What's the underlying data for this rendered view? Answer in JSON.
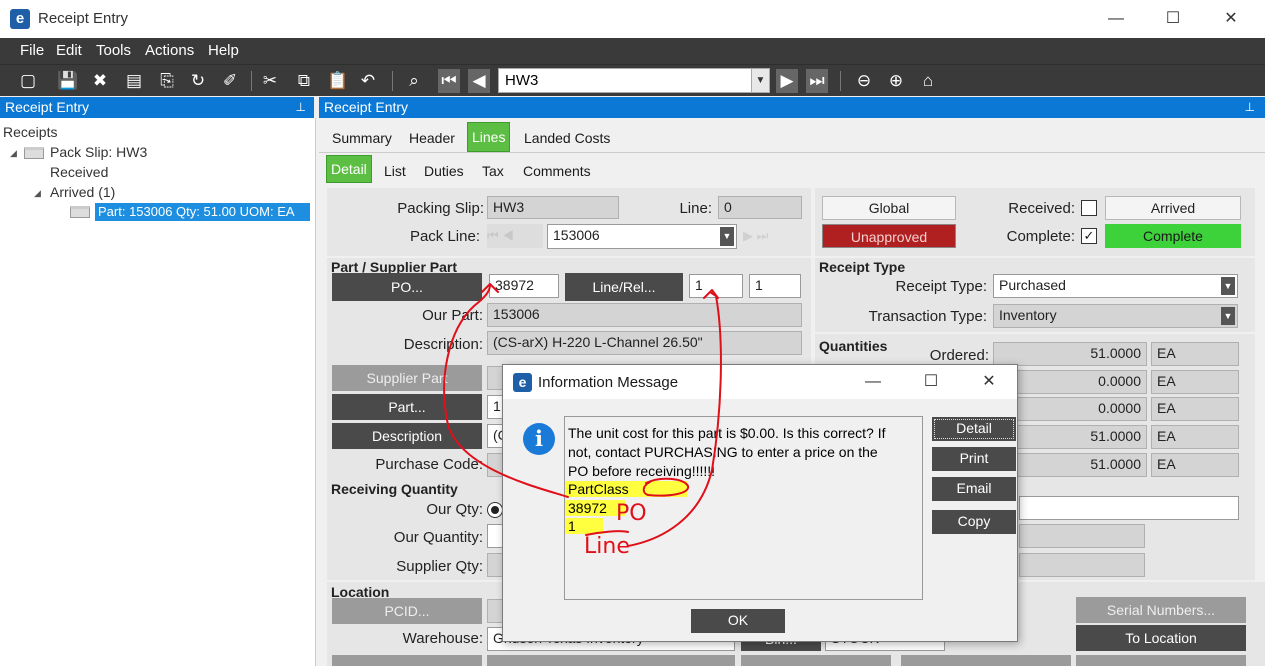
{
  "window": {
    "title": "Receipt Entry",
    "minimize": "—",
    "maximize": "☐",
    "close": "✕"
  },
  "menu": {
    "items": [
      "File",
      "Edit",
      "Tools",
      "Actions",
      "Help"
    ]
  },
  "toolbar": {
    "nav_value": "HW3"
  },
  "tree": {
    "header": "Receipt Entry",
    "root": "Receipts",
    "pack_slip": "Pack Slip: HW3",
    "received": "Received",
    "arrived": "Arrived (1)",
    "part": "Part: 153006 Qty: 51.00 UOM: EA"
  },
  "main": {
    "header": "Receipt Entry",
    "tabs": [
      "Summary",
      "Header",
      "Lines",
      "Landed Costs"
    ],
    "active_tab": "Lines",
    "subtabs": [
      "Detail",
      "List",
      "Duties",
      "Tax",
      "Comments"
    ],
    "active_subtab": "Detail"
  },
  "form": {
    "packing_slip_label": "Packing Slip:",
    "packing_slip_value": "HW3",
    "line_label": "Line:",
    "line_value": "0",
    "pack_line_label": "Pack Line:",
    "pack_line_value": "153006",
    "part_supplier_section": "Part / Supplier Part",
    "po_button": "PO...",
    "po_value": "38972",
    "line_rel_button": "Line/Rel...",
    "line_rel_value1": "1",
    "line_rel_value2": "1",
    "our_part_label": "Our Part:",
    "our_part_value": "153006",
    "description_label": "Description:",
    "description_value": "(CS-arX) H-220 L-Channel 26.50\"",
    "supplier_part_button": "Supplier Part",
    "part_button": "Part...",
    "part_value": "1",
    "description_button": "Description",
    "description_btn_value": "(C",
    "purchase_code_label": "Purchase Code:",
    "receiving_qty_section": "Receiving Quantity",
    "our_qty_label": "Our Qty:",
    "our_quantity_label": "Our Quantity:",
    "supplier_qty_label": "Supplier Qty:",
    "location_section": "Location",
    "pcid_button": "PCID...",
    "warehouse_label": "Warehouse:",
    "warehouse_value": "Ghusen Texas Inventory",
    "bin_button": "Bin...",
    "bin_value": "STOCK",
    "global_button": "Global",
    "unapproved_button": "Unapproved",
    "received_label": "Received:",
    "complete_label": "Complete:",
    "complete_check": "✓",
    "arrived_button": "Arrived",
    "complete_button": "Complete",
    "receipt_type_section": "Receipt Type",
    "receipt_type_label": "Receipt Type:",
    "receipt_type_value": "Purchased",
    "transaction_type_label": "Transaction Type:",
    "transaction_type_value": "Inventory",
    "quantities_section": "Quantities",
    "ordered_label": "Ordered:",
    "qty_rows": [
      {
        "value": "51.0000",
        "uom": "EA"
      },
      {
        "value": "0.0000",
        "uom": "EA"
      },
      {
        "value": "0.0000",
        "uom": "EA"
      },
      {
        "value": "51.0000",
        "uom": "EA"
      },
      {
        "value": "51.0000",
        "uom": "EA"
      }
    ],
    "serial_numbers_button": "Serial Numbers...",
    "to_location_button": "To Location"
  },
  "dialog": {
    "title": "Information Message",
    "message_lines": [
      "The unit cost for this part is $0.00.  Is this correct?  If",
      "not, contact PURCHASING to enter  a price on the",
      "PO before receiving!!!!!!"
    ],
    "highlight_lines": [
      "PartClass",
      "38972",
      "1"
    ],
    "buttons": {
      "detail": "Detail",
      "print": "Print",
      "email": "Email",
      "copy": "Copy",
      "ok": "OK"
    }
  },
  "annotations": {
    "po_text": "PO",
    "line_text": "Line"
  },
  "colors": {
    "accent_blue": "#0a78d4",
    "active_green": "#5cbf43",
    "unapproved_red": "#b02020",
    "highlight_yellow": "#ffff40",
    "ink_red": "#e0101a"
  }
}
